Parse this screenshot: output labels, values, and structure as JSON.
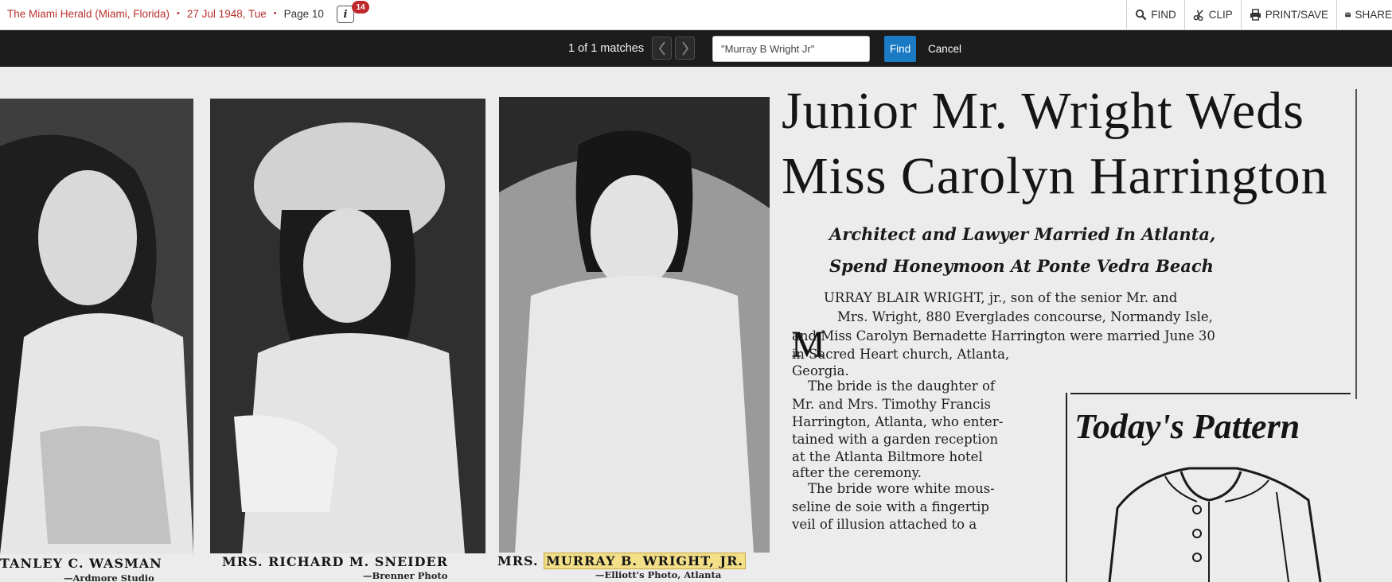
{
  "header": {
    "publication": "The Miami Herald (Miami, Florida)",
    "date": "27 Jul 1948, Tue",
    "page": "Page 10",
    "info_badge": "14",
    "info_icon": "i",
    "tools": {
      "find_label": "FIND",
      "clip_label": "CLIP",
      "print_label": "PRINT/SAVE",
      "share_label": "SHARE"
    }
  },
  "findbar": {
    "match_text": "1 of 1 matches",
    "search_value": "\"Murray B Wright Jr\"",
    "find_label": "Find",
    "cancel_label": "Cancel"
  },
  "article": {
    "photos": [
      {
        "caption": "TANLEY C. WASMAN",
        "credit": "—Ardmore Studio"
      },
      {
        "caption": "MRS. RICHARD M. SNEIDER",
        "credit": "—Brenner Photo"
      },
      {
        "caption_prefix": "MRS.",
        "caption_highlight": "MURRAY B. WRIGHT, JR.",
        "credit": "—Elliott's Photo, Atlanta"
      }
    ],
    "headline_1": "Junior Mr. Wright Weds",
    "headline_2": "Miss Carolyn Harrington",
    "subhead_1": "Architect and Lawyer Married In Atlanta,",
    "subhead_2": "Spend Honeymoon At Ponte Vedra Beach",
    "drop_cap": "M",
    "lines": [
      "URRAY BLAIR WRIGHT, jr., son of the senior Mr. and",
      "Mrs. Wright, 880 Everglades concourse, Normandy Isle,",
      "and Miss Carolyn Bernadette Harrington were married June 30",
      "in Sacred Heart church, Atlanta,",
      "Georgia.",
      "The bride is the daughter of",
      "Mr. and Mrs. Timothy Francis",
      "Harrington, Atlanta, who enter-",
      "tained with a garden reception",
      "at the Atlanta Biltmore hotel",
      "after the ceremony.",
      "The bride wore white mous-",
      "seline de soie with a fingertip",
      "veil of illusion attached to a"
    ],
    "pattern_title": "Today's Pattern"
  }
}
